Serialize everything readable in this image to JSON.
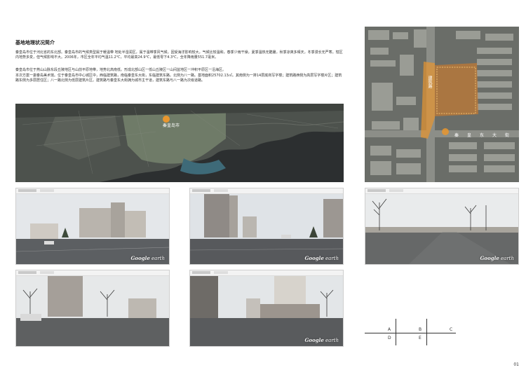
{
  "page": {
    "title": "基地地理状况简介",
    "paragraph1": "秦皇岛市位于河北省的东北部。秦皇岛市的气候类型属于暖温带 地处半湿润区，属于温带季风气候。因受海洋影响较大，气候比较温和，春季少雨干燥，夏季温热无酷暑，秋季凉爽多晴天，冬季漫长无严寒。辖区内地势多变，但气候影响不大。2006年，市区全年平均气温11.2℃，平均最高24.9℃，最低零下4.3℃，全年降雨量551.7毫米。",
    "paragraph2": "秦皇岛市位于燕山山脉东段丘陵地区与山前平原地带，地势北高南低。形成北部山区一低山丘陵区一山间盆地区一冲积平原区一沿海区。",
    "paragraph3": "本次方案一委秦岛美术馆。位于秦皇岛市中心城区中，西临建筑路，南临秦皇东大街，东临建筑东路。北侧为八一路。基地面积25702.13㎡。其南侧为一排14层底商写字楼；建筑路西侧为高层写字楼片区；建筑路东侧为多层居住区；八一路北侧为低层建筑片区。建筑路与秦皇东大街拥为城市主干道，建筑东路与八一路为次级道路。",
    "page_number": "01"
  },
  "regional_map": {
    "label": "秦皇岛市"
  },
  "site_map": {
    "road_vertical": "建筑路",
    "road_horizontal": "秦皇东大街"
  },
  "watermark": {
    "brand": "Google",
    "suffix": "earth"
  },
  "key_diagram": {
    "labels": [
      "A",
      "B",
      "C",
      "D",
      "E"
    ]
  },
  "colors": {
    "site_highlight": "#e8962f",
    "map_dark": "#3a3d3a",
    "sea": "#2a2d2f"
  }
}
